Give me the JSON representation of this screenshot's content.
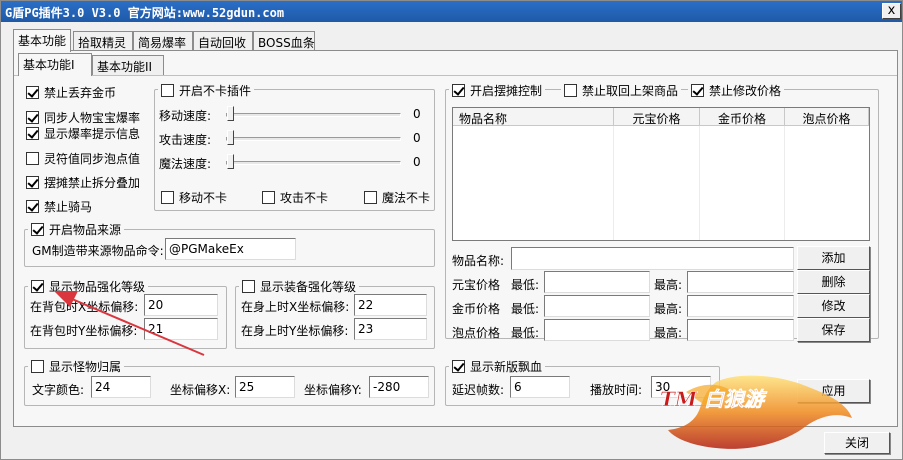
{
  "window": {
    "title": "G盾PG插件3.0 V3.0  官方网站:www.52gdun.com",
    "close_glyph": "x"
  },
  "main_tabs": [
    "基本功能",
    "拾取精灵",
    "简易爆率",
    "自动回收",
    "BOSS血条"
  ],
  "sub_tabs": [
    "基本功能I",
    "基本功能II"
  ],
  "left_checks": [
    {
      "label": "禁止丢弃金币",
      "checked": true
    },
    {
      "label": "同步人物宝宝爆率",
      "checked": true
    },
    {
      "label": "显示爆率提示信息",
      "checked": true
    },
    {
      "label": "灵符值同步泡点值",
      "checked": false
    },
    {
      "label": "摆摊禁止拆分叠加",
      "checked": true
    },
    {
      "label": "禁止骑马",
      "checked": true
    }
  ],
  "nokadun": {
    "title": "开启不卡插件",
    "checked": false,
    "sliders": [
      {
        "label": "移动速度:",
        "value": "0"
      },
      {
        "label": "攻击速度:",
        "value": "0"
      },
      {
        "label": "魔法速度:",
        "value": "0"
      }
    ],
    "checks": [
      "移动不卡",
      "攻击不卡",
      "魔法不卡"
    ]
  },
  "item_source": {
    "title": "开启物品来源",
    "checked": true,
    "cmd_label": "GM制造带来源物品命令:",
    "cmd_value": "@PGMakeEx"
  },
  "item_enhance": {
    "title": "显示物品强化等级",
    "checked": true,
    "x_label": "在背包时X坐标偏移:",
    "x_value": "20",
    "y_label": "在背包时Y坐标偏移:",
    "y_value": "21"
  },
  "equip_enhance": {
    "title": "显示装备强化等级",
    "checked": false,
    "x_label": "在身上时X坐标偏移:",
    "x_value": "22",
    "y_label": "在身上时Y坐标偏移:",
    "y_value": "23"
  },
  "monster_owner": {
    "title": "显示怪物归属",
    "checked": false,
    "color_label": "文字颜色:",
    "color_value": "24",
    "x_label": "坐标偏移X:",
    "x_value": "25",
    "y_label": "坐标偏移Y:",
    "y_value": "-280"
  },
  "stall": {
    "checks": [
      {
        "label": "开启摆摊控制",
        "checked": true
      },
      {
        "label": "禁止取回上架商品",
        "checked": false
      },
      {
        "label": "禁止修改价格",
        "checked": true
      }
    ],
    "columns": [
      "物品名称",
      "元宝价格",
      "金币价格",
      "泡点价格"
    ],
    "name_label": "物品名称:",
    "rows": [
      {
        "label": "元宝价格",
        "min": "最低:",
        "max": "最高:"
      },
      {
        "label": "金币价格",
        "min": "最低:",
        "max": "最高:"
      },
      {
        "label": "泡点价格",
        "min": "最低:",
        "max": "最高:"
      }
    ],
    "buttons": [
      "添加",
      "删除",
      "修改",
      "保存"
    ]
  },
  "blood": {
    "title": "显示新版飘血",
    "checked": true,
    "delay_label": "延迟帧数:",
    "delay_value": "6",
    "play_label": "播放时间:",
    "play_value": "30"
  },
  "apply_label": "应用",
  "close_label": "关闭",
  "logo_text": "TM 白狼游",
  "colors": {
    "titlebar": "#1f5aa8",
    "arrow": "#d9363e",
    "logo_fire": "#e8601c"
  }
}
